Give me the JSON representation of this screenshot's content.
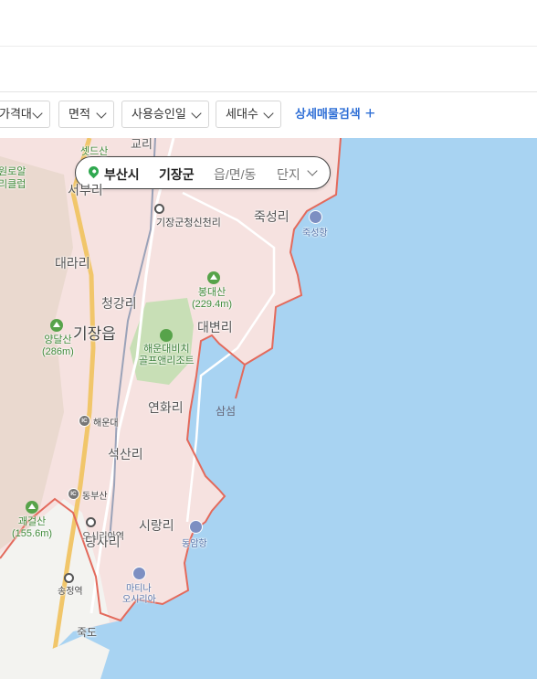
{
  "filters": {
    "price_range": "가격대",
    "area": "면적",
    "approval_date": "사용승인일",
    "households": "세대수",
    "detail_search": "상세매물검색",
    "detail_plus": "+"
  },
  "location": {
    "city": "부산시",
    "district": "기장군",
    "town": "읍/면/동",
    "complex": "단지"
  },
  "colors": {
    "land": "#f6e2e0",
    "sea": "#a8d3f2",
    "boundary": "#e36a5c",
    "park": "#c8dfb6",
    "accent": "#2f6fd6"
  },
  "map_labels": {
    "gyori": "교리",
    "seokdeusan": "셋드산",
    "wolyo": "원로알",
    "resort_part": "리클럽",
    "seobu": "서부리",
    "sinchon_stop": "기장군청신천리",
    "jukseongri": "죽성리",
    "jukseonghang": "죽성항",
    "daerari": "대라리",
    "bongdaesan": "봉대산",
    "bongdaesan_height": "(229.4m)",
    "cheonggangri": "청강리",
    "gijang_eup": "기장읍",
    "daebyeonri": "대변리",
    "yangdalsan": "양달산",
    "yangdalsan_height": "(286m)",
    "golf_club_1": "해운대비치",
    "golf_club_2": "골프앤리조트",
    "samseom": "삼섬",
    "yeonhwari": "연화리",
    "ic_haeundae": "해운대",
    "seoksanri": "석산리",
    "ic_dongbusan": "동부산",
    "gwaegeolsan": "괘걸산",
    "gwaegeolsan_height": "(155.6m)",
    "osiria_station": "오시리아역",
    "sirangri": "시랑리",
    "dongamhang": "동암항",
    "dongsari": "당사리",
    "songjeong_station": "송정역",
    "marina_1": "마티나",
    "marina_2": "오시리아",
    "jukdo": "죽도",
    "ic_badge": "IC"
  }
}
